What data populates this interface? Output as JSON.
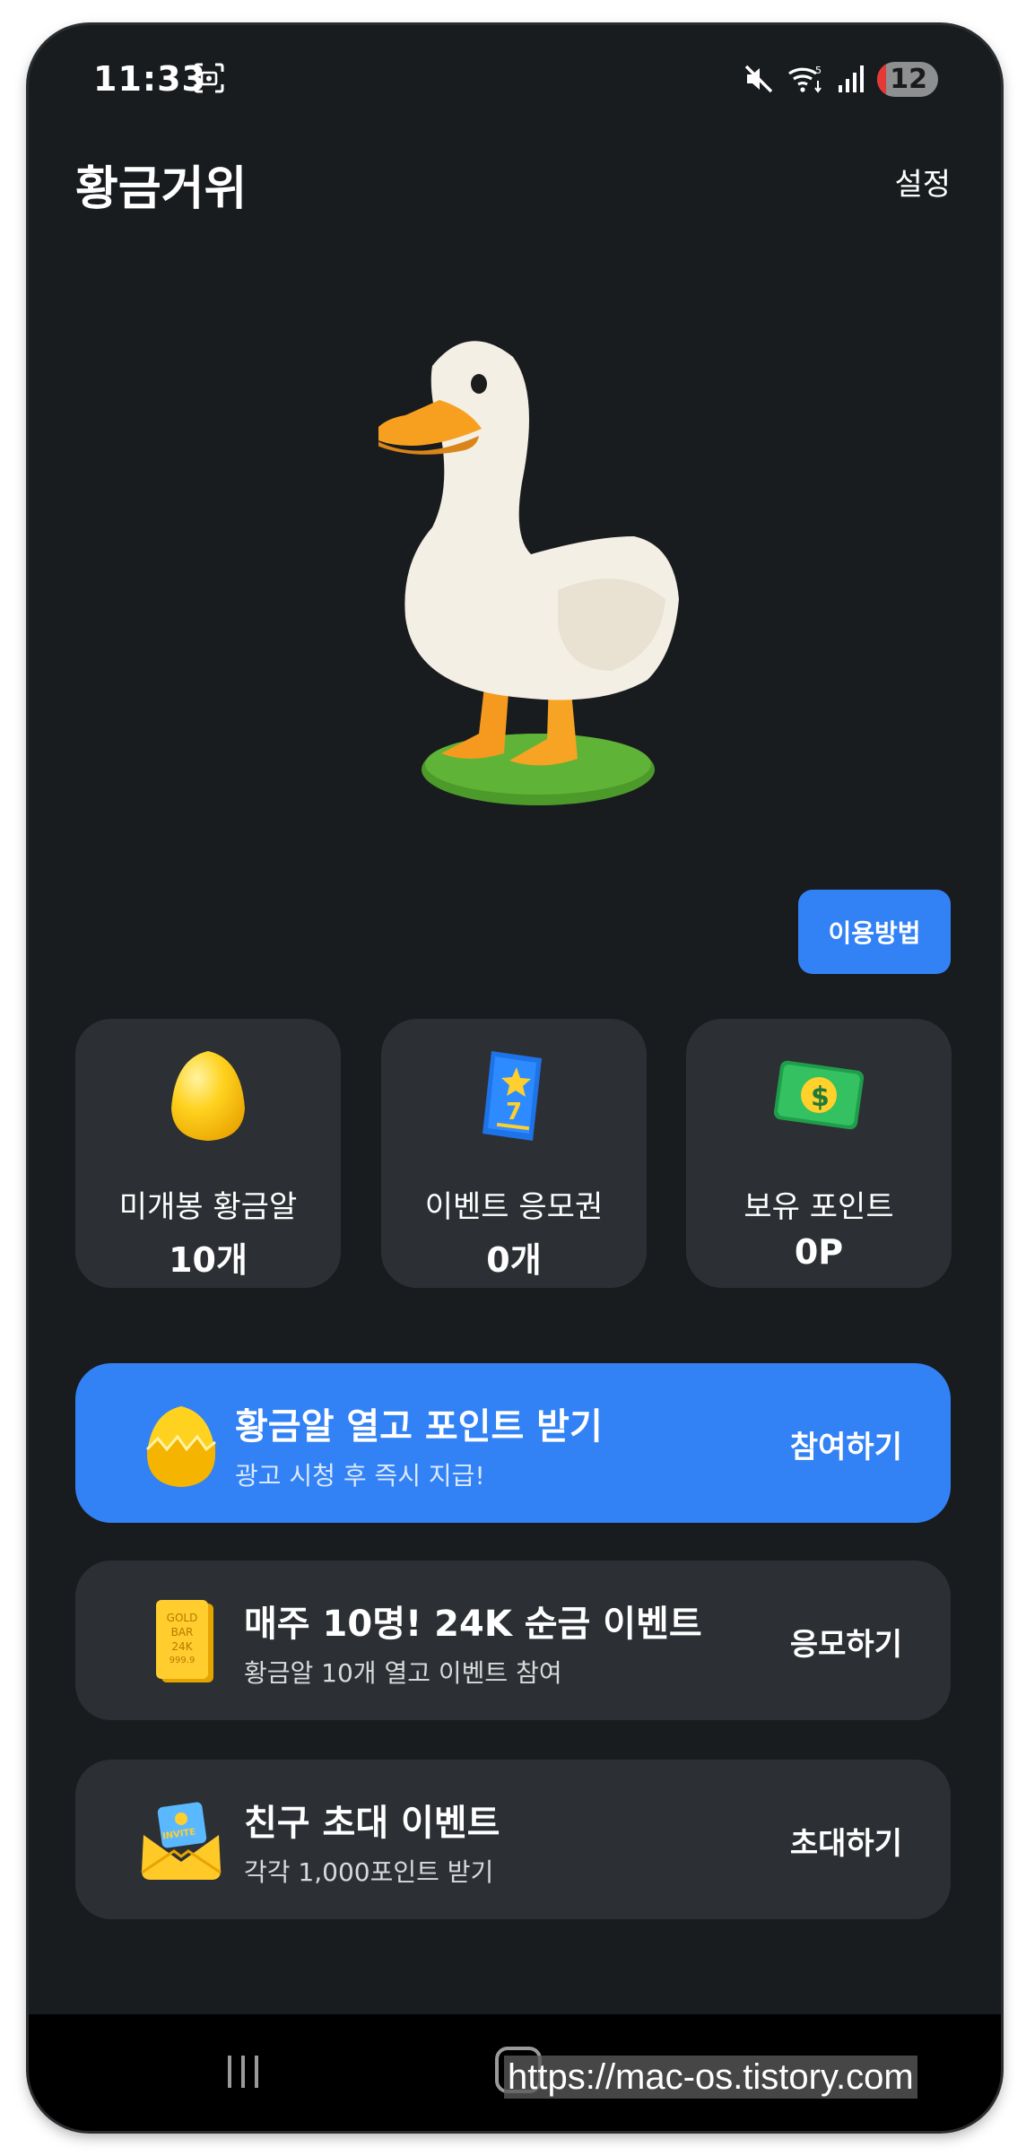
{
  "status": {
    "time": "11:33",
    "notification_count": "12"
  },
  "header": {
    "title": "황금거위",
    "settings_label": "설정"
  },
  "howto_label": "이용방법",
  "stats": [
    {
      "label": "미개봉 황금알",
      "value": "10개",
      "icon": "golden-egg-icon"
    },
    {
      "label": "이벤트 응모권",
      "value": "0개",
      "icon": "ticket-icon"
    },
    {
      "label": "보유 포인트",
      "value": "0P",
      "icon": "money-icon"
    }
  ],
  "cards": [
    {
      "title": "황금알 열고 포인트 받기",
      "subtitle": "광고 시청 후 즉시 지급!",
      "action": "참여하기",
      "icon": "cracked-egg-icon"
    },
    {
      "title": "매주 10명! 24K 순금 이벤트",
      "subtitle": "황금알 10개 열고 이벤트 참여",
      "action": "응모하기",
      "icon": "gold-bar-icon",
      "icon_text": [
        "GOLD",
        "BAR",
        "24K",
        "999.9"
      ]
    },
    {
      "title": "친구 초대 이벤트",
      "subtitle": "각각 1,000포인트 받기",
      "action": "초대하기",
      "icon": "invite-envelope-icon",
      "icon_text": "INVITE"
    }
  ],
  "watermark": "https://mac-os.tistory.com",
  "colors": {
    "background": "#191c1e",
    "card": "#2c3034",
    "accent": "#3282f6"
  }
}
